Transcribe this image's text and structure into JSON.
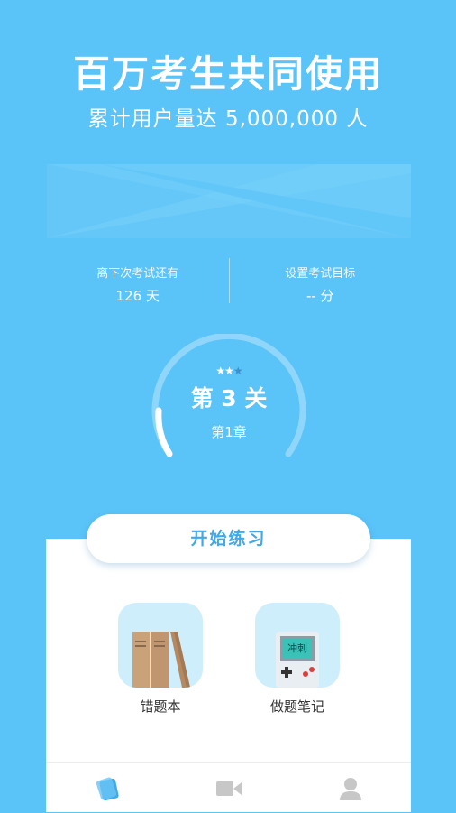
{
  "header": {
    "headline": "百万考生共同使用",
    "subline": "累计用户量达 5,000,000 人"
  },
  "stats": {
    "exam_countdown_label": "离下次考试还有",
    "exam_countdown_value": "126 天",
    "target_score_label": "设置考试目标",
    "target_score_value": "-- 分"
  },
  "progress": {
    "stars_earned": 2,
    "stars_total": 3,
    "level": "第 3 关",
    "chapter": "第1章"
  },
  "actions": {
    "start_practice_label": "开始练习"
  },
  "features": [
    {
      "label": "错题本",
      "icon": "books-icon"
    },
    {
      "label": "做题笔记",
      "icon": "game-console-icon",
      "screen_text": "冲刺"
    }
  ],
  "tabbar": {
    "items": [
      {
        "name": "practice",
        "icon": "cards-icon",
        "active": true
      },
      {
        "name": "video",
        "icon": "video-camera-icon",
        "active": false
      },
      {
        "name": "profile",
        "icon": "user-icon",
        "active": false
      }
    ]
  },
  "colors": {
    "background": "#5ac3f7",
    "accent": "#3fa9ea",
    "tile": "#cfeefc",
    "tab_inactive": "#c7c7c7"
  }
}
